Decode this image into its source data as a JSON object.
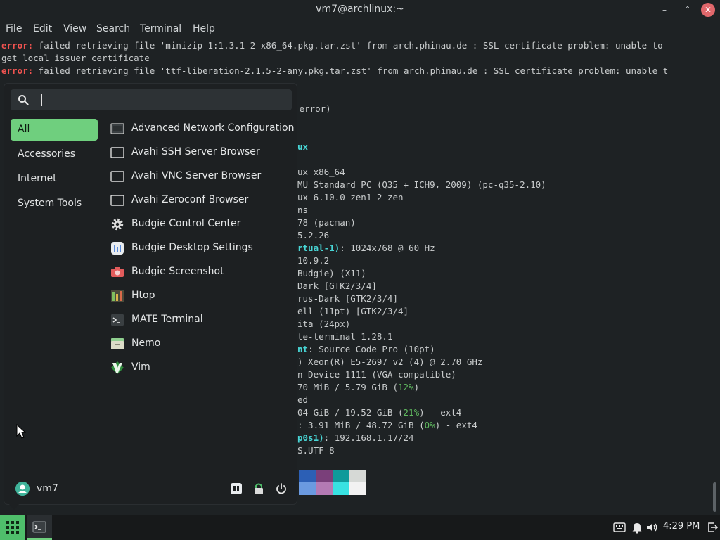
{
  "window": {
    "title": "vm7@archlinux:~",
    "minimize": "–",
    "maximize": "⌃",
    "close": "✕"
  },
  "menubar": [
    "File",
    "Edit",
    "View",
    "Search",
    "Terminal",
    "Help"
  ],
  "terminal_lines": [
    {
      "prefix": "error:",
      "text": " failed retrieving file 'minizip-1:1.3.1-2-x86_64.pkg.tar.zst' from arch.phinau.de : SSL certificate problem: unable to"
    },
    {
      "prefix": "",
      "text": "get local issuer certificate"
    },
    {
      "prefix": "error:",
      "text": " failed retrieving file 'ttf-liberation-2.1.5-2-any.pkg.tar.zst' from arch.phinau.de : SSL certificate problem: unable t"
    }
  ],
  "neofetch": {
    "error_fragment": " error)",
    "user_fragment": "ux",
    "separator": "--",
    "os": "ux x86_64",
    "host": "MU Standard PC (Q35 + ICH9, 2009) (pc-q35-2.10)",
    "kernel": "ux 6.10.0-zen1-2-zen",
    "uptime": "ns",
    "packages": "78 (pacman)",
    "shell": "5.2.26",
    "display_label": "rtual-1)",
    "display_value": ": 1024x768 @ 60 Hz",
    "de": "10.9.2",
    "wm": "Budgie) (X11)",
    "theme": "Dark [GTK2/3/4]",
    "icons": "rus-Dark [GTK2/3/4]",
    "font": "ell (11pt) [GTK2/3/4]",
    "cursor": "ita (24px)",
    "terminal": "te-terminal 1.28.1",
    "terminal_font_label": "nt",
    "terminal_font_value": ": Source Code Pro (10pt)",
    "cpu": ") Xeon(R) E5-2697 v2 (4) @ 2.70 GHz",
    "gpu": "n Device 1111 (VGA compatible)",
    "memory_prefix": "70 MiB / 5.79 GiB (",
    "memory_pct": "12%",
    "memory_suffix": ")",
    "swap": "ed",
    "disk1_prefix": "04 GiB / 19.52 GiB (",
    "disk1_pct": "21%",
    "disk1_suffix": ") - ext4",
    "disk2_prefix": ": 3.91 MiB / 48.72 GiB (",
    "disk2_pct": "0%",
    "disk2_suffix": ") - ext4",
    "ip_label": "p0s1)",
    "ip_value": ": 192.168.1.17/24",
    "locale": "S.UTF-8"
  },
  "palette": {
    "row1": [
      "#2c5fb5",
      "#7a3f7a",
      "#0e9a9a",
      "#d6d9d6"
    ],
    "row2": [
      "#6b9ae0",
      "#b47ab4",
      "#38e2e2",
      "#f2f2f2"
    ]
  },
  "launcher": {
    "search": {
      "placeholder": "",
      "value": ""
    },
    "categories": [
      "All",
      "Accessories",
      "Internet",
      "System Tools"
    ],
    "apps": [
      {
        "label": "Advanced Network Configuration",
        "icon": "network-icon"
      },
      {
        "label": "Avahi SSH Server Browser",
        "icon": "avahi-ssh-icon"
      },
      {
        "label": "Avahi VNC Server Browser",
        "icon": "avahi-vnc-icon"
      },
      {
        "label": "Avahi Zeroconf Browser",
        "icon": "avahi-zeroconf-icon"
      },
      {
        "label": "Budgie Control Center",
        "icon": "gear-icon"
      },
      {
        "label": "Budgie Desktop Settings",
        "icon": "budgie-settings-icon"
      },
      {
        "label": "Budgie Screenshot",
        "icon": "camera-icon"
      },
      {
        "label": "Htop",
        "icon": "htop-icon"
      },
      {
        "label": "MATE Terminal",
        "icon": "terminal-icon"
      },
      {
        "label": "Nemo",
        "icon": "folder-icon"
      },
      {
        "label": "Vim",
        "icon": "vim-icon"
      }
    ],
    "user": "vm7"
  },
  "panel": {
    "clock": "4:29 PM"
  },
  "colors": {
    "accent": "#6fcf7e",
    "error": "#ef5350",
    "cyan": "#48d6d6"
  }
}
